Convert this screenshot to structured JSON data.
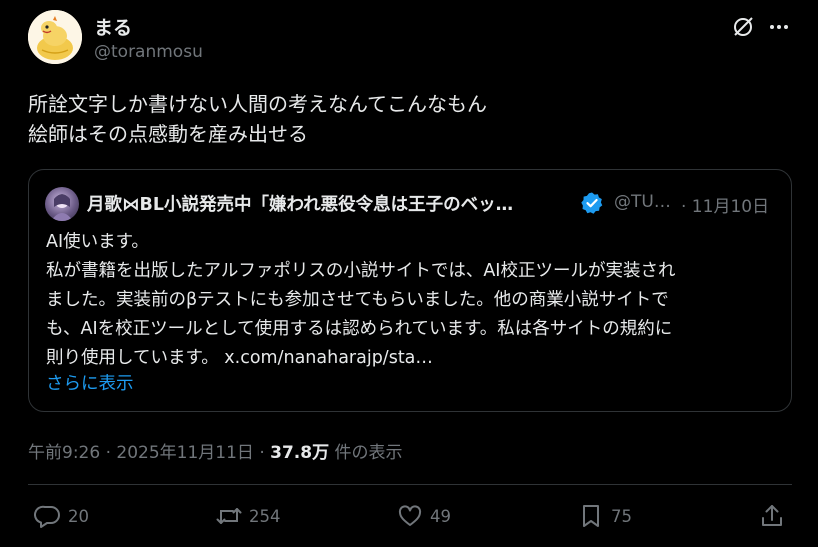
{
  "author": {
    "name": "まる",
    "handle": "@toranmosu"
  },
  "tweet": {
    "lines": [
      "所詮文字しか書けない人間の考えなんてこんなもん",
      "絵師はその点感動を産み出せる"
    ]
  },
  "quote": {
    "name": "月歌⋈BL小説発売中「嫌われ悪役令息は王子のベッ…",
    "handle": "@TU…",
    "date": "· 11月10日",
    "lines": [
      "AI使います。",
      "私が書籍を出版したアルファポリスの小説サイトでは、AI校正ツールが実装され",
      "ました。実装前のβテストにも参加させてもらいました。他の商業小説サイトで",
      "も、AIを校正ツールとして使用するは認められています。私は各サイトの規約に",
      "則り使用しています。 x.com/nanaharajp/sta…"
    ],
    "show_more": "さらに表示"
  },
  "meta": {
    "time": "午前9:26 · 2025年11月11日 · ",
    "views": "37.8万",
    "views_label": " 件の表示"
  },
  "actions": {
    "replies": "20",
    "reposts": "254",
    "likes": "49",
    "bookmarks": "75"
  },
  "colors": {
    "background": "#000000",
    "text": "#e7e9ea",
    "secondary": "#71767b",
    "link": "#1d9bf0",
    "border": "#2f3336"
  },
  "icons": [
    "grok-icon",
    "more-icon",
    "verified-icon",
    "reply-icon",
    "repost-icon",
    "like-icon",
    "bookmark-icon",
    "share-icon"
  ]
}
